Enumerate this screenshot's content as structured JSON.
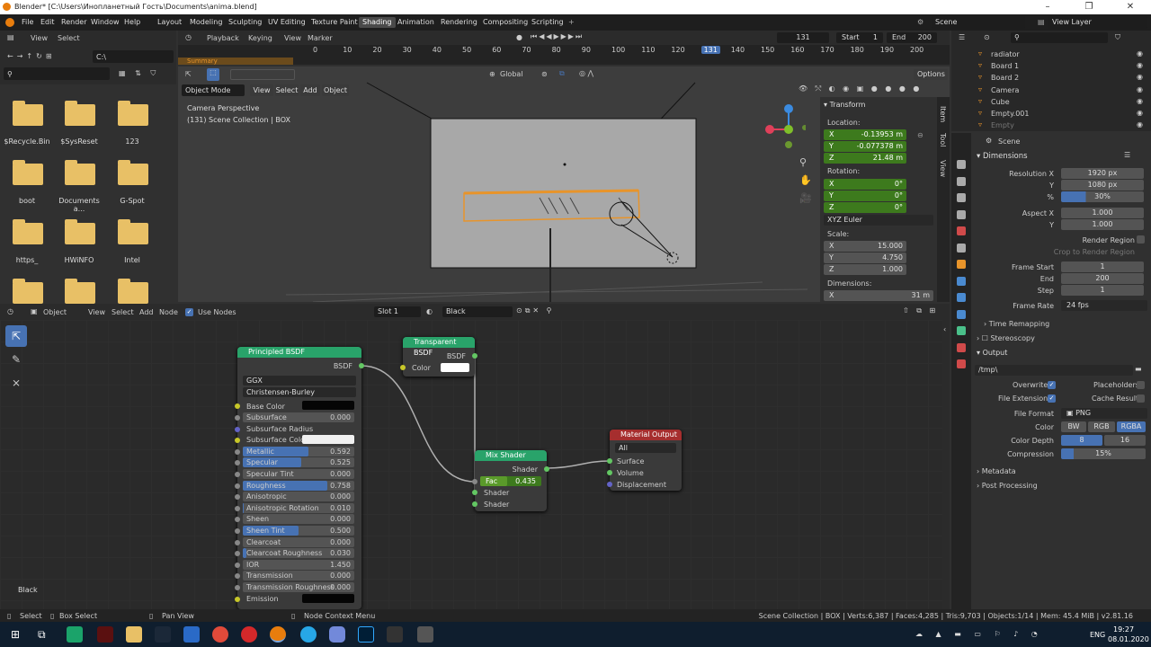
{
  "window": {
    "title": "Blender* [C:\\Users\\Инопланетный Гость\\Documents\\anima.blend]"
  },
  "menu": [
    "File",
    "Edit",
    "Render",
    "Window",
    "Help"
  ],
  "workspaces": [
    "Layout",
    "Modeling",
    "Sculpting",
    "UV Editing",
    "Texture Paint",
    "Shading",
    "Animation",
    "Rendering",
    "Compositing",
    "Scripting"
  ],
  "active_workspace": "Shading",
  "top_right": {
    "scene": "Scene",
    "view_layer": "View Layer"
  },
  "timeline": {
    "menus": [
      "Playback",
      "Keying",
      "View",
      "Marker"
    ],
    "current_frame": "131",
    "start_label": "Start",
    "start": "1",
    "end_label": "End",
    "end": "200",
    "ticks": [
      "0",
      "10",
      "20",
      "30",
      "40",
      "50",
      "60",
      "70",
      "80",
      "90",
      "100",
      "110",
      "120",
      "131",
      "140",
      "150",
      "160",
      "170",
      "180",
      "190",
      "200"
    ],
    "summary": "Summary"
  },
  "file_browser": {
    "path": "C:\\",
    "files": [
      "$Recycle.Bin",
      "$SysReset",
      "123",
      "boot",
      "Documents a...",
      "G-Spot",
      "https_",
      "HWiNFO",
      "Intel"
    ]
  },
  "viewport": {
    "mode": "Object Mode",
    "menus": [
      "View",
      "Select",
      "Add",
      "Object"
    ],
    "orientation": "Global",
    "camera_label": "Camera Perspective",
    "collection_label": "(131) Scene Collection | BOX",
    "options": "Options"
  },
  "transform": {
    "title": "Transform",
    "location_label": "Location:",
    "loc": [
      {
        "axis": "X",
        "value": "-0.13953 m"
      },
      {
        "axis": "Y",
        "value": "-0.077378 m"
      },
      {
        "axis": "Z",
        "value": "21.48 m"
      }
    ],
    "rotation_label": "Rotation:",
    "rot": [
      {
        "axis": "X",
        "value": "0°"
      },
      {
        "axis": "Y",
        "value": "0°"
      },
      {
        "axis": "Z",
        "value": "0°"
      }
    ],
    "euler": "XYZ Euler",
    "scale_label": "Scale:",
    "scale": [
      {
        "axis": "X",
        "value": "15.000"
      },
      {
        "axis": "Y",
        "value": "4.750"
      },
      {
        "axis": "Z",
        "value": "1.000"
      }
    ],
    "dimensions_label": "Dimensions:",
    "dim": [
      {
        "axis": "X",
        "value": "31 m"
      }
    ],
    "tabs": [
      "Item",
      "Tool",
      "View"
    ]
  },
  "outliner": {
    "items": [
      "radiator",
      "Board 1",
      "Board 2",
      "Camera",
      "Cube",
      "Empty.001",
      "Empty"
    ]
  },
  "properties": {
    "scene": "Scene",
    "dimensions": "Dimensions",
    "res_x_label": "Resolution X",
    "res_x": "1920 px",
    "res_y_label": "Y",
    "res_y": "1080 px",
    "pct_label": "%",
    "pct": "30%",
    "aspect_x_label": "Aspect X",
    "aspect_x": "1.000",
    "aspect_y_label": "Y",
    "aspect_y": "1.000",
    "render_region": "Render Region",
    "crop": "Crop to Render Region",
    "frame_start_label": "Frame Start",
    "frame_start": "1",
    "end_label": "End",
    "end": "200",
    "step_label": "Step",
    "step": "1",
    "frame_rate_label": "Frame Rate",
    "frame_rate": "24 fps",
    "time_remapping": "Time Remapping",
    "stereoscopy": "Stereoscopy",
    "output": "Output",
    "output_path": "/tmp\\",
    "overwrite": "Overwrite",
    "placeholders": "Placeholders",
    "file_extensions": "File Extensions",
    "cache_result": "Cache Result",
    "file_format_label": "File Format",
    "file_format": "PNG",
    "color_label": "Color",
    "color_opts": [
      "BW",
      "RGB",
      "RGBA"
    ],
    "depth_label": "Color Depth",
    "depth_opts": [
      "8",
      "16"
    ],
    "compression_label": "Compression",
    "compression": "15%",
    "metadata": "Metadata",
    "post_processing": "Post Processing"
  },
  "node_editor": {
    "object": "Object",
    "menus": [
      "View",
      "Select",
      "Add",
      "Node"
    ],
    "use_nodes": "Use Nodes",
    "slot": "Slot 1",
    "material": "Black",
    "bottom_label": "Black"
  },
  "principled": {
    "title": "Principled BSDF",
    "out": "BSDF",
    "dist": "GGX",
    "sss": "Christensen-Burley",
    "base_color": "Base Color",
    "rows": [
      {
        "n": "Subsurface",
        "v": "0.000",
        "f": 0
      },
      {
        "n": "Subsurface Radius",
        "v": "",
        "f": 0
      },
      {
        "n": "Subsurface Color",
        "v": "",
        "f": 0
      },
      {
        "n": "Metallic",
        "v": "0.592",
        "f": 0.592
      },
      {
        "n": "Specular",
        "v": "0.525",
        "f": 0.525
      },
      {
        "n": "Specular Tint",
        "v": "0.000",
        "f": 0
      },
      {
        "n": "Roughness",
        "v": "0.758",
        "f": 0.758
      },
      {
        "n": "Anisotropic",
        "v": "0.000",
        "f": 0
      },
      {
        "n": "Anisotropic Rotation",
        "v": "0.010",
        "f": 0.01
      },
      {
        "n": "Sheen",
        "v": "0.000",
        "f": 0
      },
      {
        "n": "Sheen Tint",
        "v": "0.500",
        "f": 0.5
      },
      {
        "n": "Clearcoat",
        "v": "0.000",
        "f": 0
      },
      {
        "n": "Clearcoat Roughness",
        "v": "0.030",
        "f": 0.03
      },
      {
        "n": "IOR",
        "v": "1.450",
        "f": 0
      },
      {
        "n": "Transmission",
        "v": "0.000",
        "f": 0
      },
      {
        "n": "Transmission Roughness",
        "v": "0.000",
        "f": 0
      },
      {
        "n": "Emission",
        "v": "",
        "f": 0
      }
    ]
  },
  "transparent": {
    "title": "Transparent BSDF",
    "out": "BSDF",
    "color": "Color"
  },
  "mix": {
    "title": "Mix Shader",
    "out": "Shader",
    "fac": "Fac",
    "fac_val": "0.435",
    "fac_fill": 0.435,
    "in1": "Shader",
    "in2": "Shader"
  },
  "output": {
    "title": "Material Output",
    "target": "All",
    "surface": "Surface",
    "volume": "Volume",
    "displacement": "Displacement"
  },
  "status": {
    "select": "Select",
    "box": "Box Select",
    "pan": "Pan View",
    "ctx": "Node Context Menu",
    "info": "Scene Collection | BOX | Verts:6,387 | Faces:4,285 | Tris:9,703 | Objects:1/14 | Mem: 45.4 MiB | v2.81.16"
  },
  "taskbar": {
    "time": "19:27",
    "date": "08.01.2020",
    "lang": "ENG"
  },
  "colors": {
    "accent": "#4772b3",
    "green_field": "#3d7a1d",
    "principled_head": "#29a36a",
    "output_head": "#a62e2e",
    "selection": "#e8942a"
  }
}
